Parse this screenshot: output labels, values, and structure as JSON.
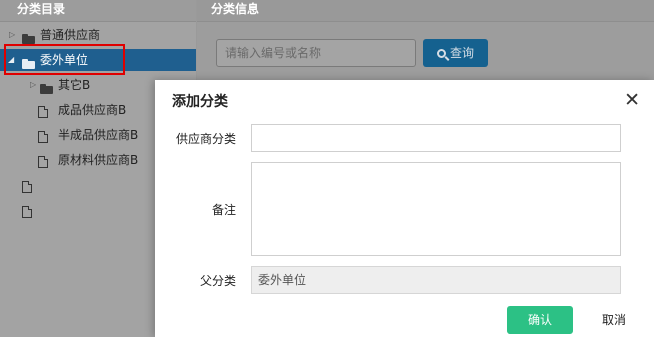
{
  "tree_panel": {
    "header": "分类目录",
    "nodes": [
      {
        "label": "普通供应商"
      },
      {
        "label": "委外单位"
      },
      {
        "label": "其它B"
      },
      {
        "label": "成品供应商B"
      },
      {
        "label": "半成品供应商B"
      },
      {
        "label": "原材料供应商B"
      }
    ]
  },
  "info_panel": {
    "header": "分类信息",
    "search_placeholder": "请输入编号或名称",
    "search_button": "查询"
  },
  "dialog": {
    "title": "添加分类",
    "supplier_category_label": "供应商分类",
    "supplier_category_value": "",
    "remark_label": "备注",
    "remark_value": "",
    "parent_label": "父分类",
    "parent_value": "委外单位",
    "confirm_button": "确认",
    "cancel_button": "取消"
  },
  "colors": {
    "selected_node": "#1f5f8f",
    "highlight_border": "#e00000",
    "search_button": "#15618f",
    "confirm_button": "#2cc185"
  },
  "icons": [
    "folder-icon",
    "file-icon",
    "expand-arrow-icon",
    "search-icon",
    "close-icon"
  ]
}
